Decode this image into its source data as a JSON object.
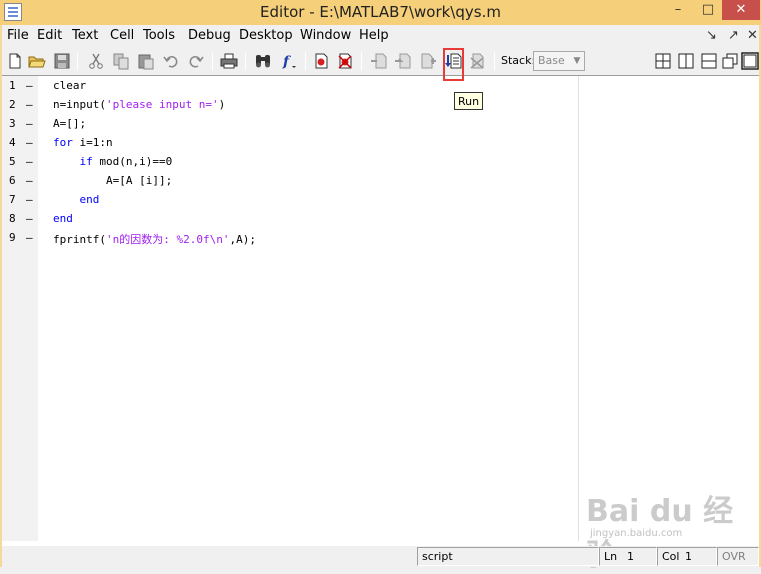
{
  "window": {
    "title": "Editor - E:\\MATLAB7\\work\\qys.m",
    "minimize": "–",
    "maximize": "□",
    "close": "✕"
  },
  "menu": {
    "file": "File",
    "edit": "Edit",
    "text": "Text",
    "cell": "Cell",
    "tools": "Tools",
    "debug": "Debug",
    "desktop": "Desktop",
    "window": "Window",
    "help": "Help",
    "mdi_undock": "↘",
    "mdi_dock": "↗",
    "mdi_close": "✕"
  },
  "toolbar": {
    "stack_label": "Stack:",
    "stack_value": "Base"
  },
  "tooltip": {
    "text": "Run"
  },
  "editor": {
    "line_numbers": [
      "1",
      "2",
      "3",
      "4",
      "5",
      "6",
      "7",
      "8",
      "9"
    ],
    "breakpoint_marker": "–",
    "code": [
      {
        "parts": [
          {
            "type": "plain",
            "text": "clear"
          }
        ]
      },
      {
        "parts": [
          {
            "type": "plain",
            "text": "n=input("
          },
          {
            "type": "string",
            "text": "'please input n='"
          },
          {
            "type": "plain",
            "text": ")"
          }
        ]
      },
      {
        "parts": [
          {
            "type": "plain",
            "text": "A=[];"
          }
        ]
      },
      {
        "parts": [
          {
            "type": "keyword",
            "text": "for"
          },
          {
            "type": "plain",
            "text": " i=1:n"
          }
        ]
      },
      {
        "parts": [
          {
            "type": "plain",
            "text": "    "
          },
          {
            "type": "keyword",
            "text": "if"
          },
          {
            "type": "plain",
            "text": " mod(n,i)==0"
          }
        ]
      },
      {
        "parts": [
          {
            "type": "plain",
            "text": "        A=[A [i]];"
          }
        ]
      },
      {
        "parts": [
          {
            "type": "plain",
            "text": "    "
          },
          {
            "type": "keyword",
            "text": "end"
          }
        ]
      },
      {
        "parts": [
          {
            "type": "keyword",
            "text": "end"
          }
        ]
      },
      {
        "parts": [
          {
            "type": "plain",
            "text": "fprintf("
          },
          {
            "type": "string",
            "text": "'n的因数为: %2.0f\\n'"
          },
          {
            "type": "plain",
            "text": ",A);"
          }
        ]
      }
    ]
  },
  "statusbar": {
    "mode": "script",
    "ln_label": "Ln",
    "ln_value": "1",
    "col_label": "Col",
    "col_value": "1",
    "ovr": "OVR"
  },
  "watermark": {
    "logo": "Bai du 经验",
    "site": "jingyan.baidu.com"
  },
  "colors": {
    "keyword": "#0000ff",
    "string": "#a020f0",
    "highlight": "#e83b38",
    "titlebar": "#f6cf7a"
  }
}
